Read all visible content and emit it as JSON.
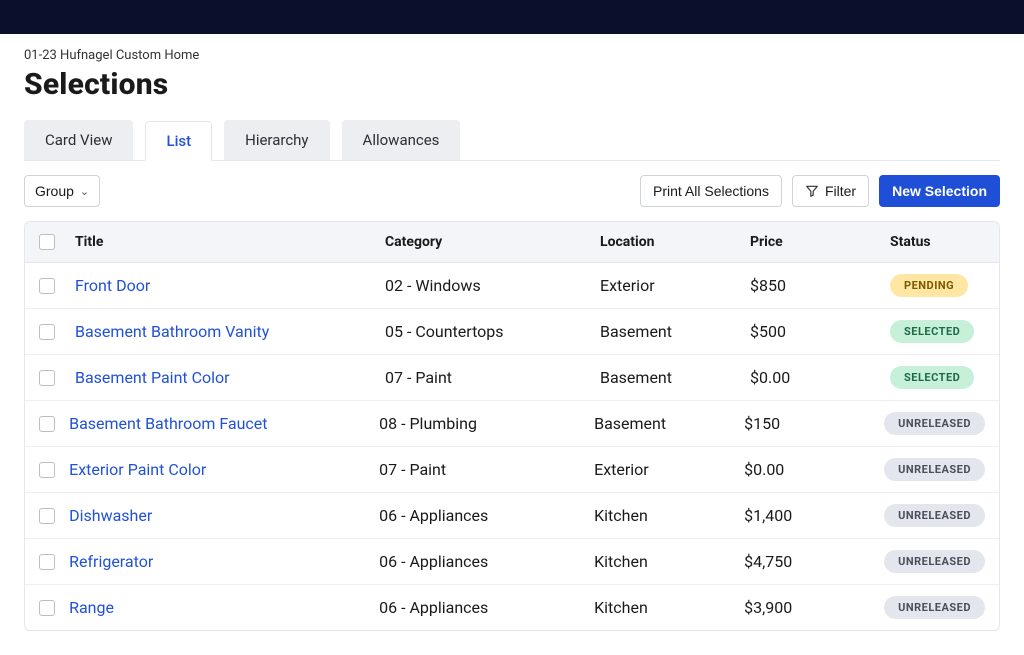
{
  "header": {
    "breadcrumb": "01-23 Hufnagel Custom Home",
    "title": "Selections"
  },
  "tabs": [
    {
      "label": "Card View",
      "active": false
    },
    {
      "label": "List",
      "active": true
    },
    {
      "label": "Hierarchy",
      "active": false
    },
    {
      "label": "Allowances",
      "active": false
    }
  ],
  "toolbar": {
    "group_label": "Group",
    "print_label": "Print All Selections",
    "filter_label": "Filter",
    "new_label": "New Selection"
  },
  "table": {
    "columns": {
      "title": "Title",
      "category": "Category",
      "location": "Location",
      "price": "Price",
      "status": "Status"
    },
    "rows": [
      {
        "title": "Front Door",
        "category": "02 - Windows",
        "location": "Exterior",
        "price": "$850",
        "status": "PENDING",
        "status_class": "pending"
      },
      {
        "title": "Basement Bathroom Vanity",
        "category": "05 - Countertops",
        "location": "Basement",
        "price": "$500",
        "status": "SELECTED",
        "status_class": "selected"
      },
      {
        "title": "Basement Paint Color",
        "category": "07 - Paint",
        "location": "Basement",
        "price": "$0.00",
        "status": "SELECTED",
        "status_class": "selected"
      },
      {
        "title": "Basement Bathroom Faucet",
        "category": "08 - Plumbing",
        "location": "Basement",
        "price": "$150",
        "status": "UNRELEASED",
        "status_class": "unreleased"
      },
      {
        "title": "Exterior Paint Color",
        "category": "07 - Paint",
        "location": "Exterior",
        "price": "$0.00",
        "status": "UNRELEASED",
        "status_class": "unreleased"
      },
      {
        "title": "Dishwasher",
        "category": "06 - Appliances",
        "location": "Kitchen",
        "price": "$1,400",
        "status": "UNRELEASED",
        "status_class": "unreleased"
      },
      {
        "title": "Refrigerator",
        "category": "06 - Appliances",
        "location": "Kitchen",
        "price": "$4,750",
        "status": "UNRELEASED",
        "status_class": "unreleased"
      },
      {
        "title": "Range",
        "category": "06 - Appliances",
        "location": "Kitchen",
        "price": "$3,900",
        "status": "UNRELEASED",
        "status_class": "unreleased"
      }
    ]
  }
}
